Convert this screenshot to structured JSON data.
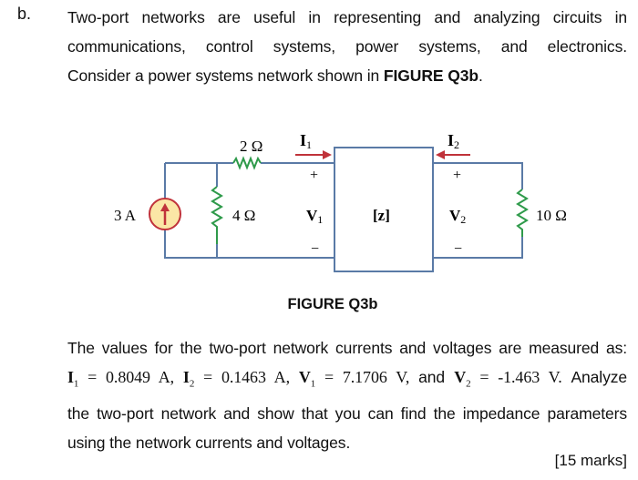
{
  "question": {
    "part_label": "b.",
    "intro_lines": [
      "Two-port networks are useful in representing and analyzing circuits in",
      "communications, control systems, power systems, and electronics."
    ],
    "intro_last_prefix": "Consider a power systems network shown in ",
    "intro_last_bold": "FIGURE Q3b",
    "intro_last_suffix": ".",
    "figure_caption": "FIGURE Q3b",
    "body_line1": "The values for the two-port network currents and voltages are measured as:",
    "measurements": {
      "I1_label": "I",
      "I1_sub": "1",
      "I1_value": " = 0.8049 A, ",
      "I2_label": "I",
      "I2_sub": "2",
      "I2_value": " = 0.1463 A, ",
      "V1_label": "V",
      "V1_sub": "1",
      "V1_value": " = 7.1706 V, ",
      "and_text": "and ",
      "V2_label": "V",
      "V2_sub": "2",
      "V2_value": " = -1.463 V. ",
      "tail": "Analyze"
    },
    "body_line3": "the two-port network and show that you can find the impedance parameters",
    "body_line4": "using the network currents and voltages.",
    "marks": "[15 marks]"
  },
  "circuit": {
    "source_label": "3 A",
    "r_series_label": "2 Ω",
    "r_shunt_label": "4 Ω",
    "r_load_label": "10 Ω",
    "network_label": "[z]",
    "i1_label": "I",
    "i1_sub": "1",
    "i2_label": "I",
    "i2_sub": "2",
    "v1_label": "V",
    "v1_sub": "1",
    "v2_label": "V",
    "v2_sub": "2",
    "plus": "+",
    "minus": "−",
    "colors": {
      "wire": "#5a7aa6",
      "resistor": "#2e9a4a",
      "arrow": "#c0323a",
      "source_fill": "#fbe6a6",
      "source_stroke": "#c0323a"
    }
  }
}
